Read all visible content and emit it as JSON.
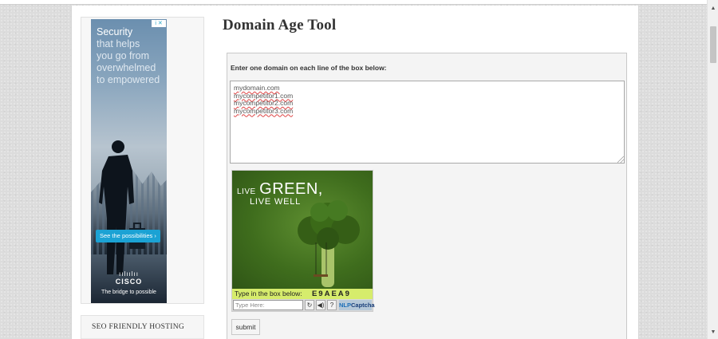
{
  "sidebar": {
    "ad": {
      "lines": [
        "Security",
        "that helps",
        "you go from",
        "overwhelmed",
        "to empowered"
      ],
      "badge": "i ✕",
      "cta": "See the possibilities ›",
      "logo_bars": "ıılıılıı",
      "brand": "CISCO",
      "tagline": "The bridge to possible"
    },
    "box_title": "SEO FRIENDLY HOSTING"
  },
  "main": {
    "title": "Domain Age Tool",
    "instruction": "Enter one domain on each line of the box below:",
    "domains": [
      "mydomain.com",
      "mycompetitor1.com",
      "mycompetitor2.com",
      "mycompetitor3.com"
    ],
    "captcha": {
      "live_small": "LIVE",
      "live_big": "GREEN,",
      "live_well": "LIVE WELL",
      "prompt": "Type in the box below:",
      "code": "E9AEA9",
      "input_placeholder": "Type Here:",
      "refresh": "↻",
      "audio": "◀)",
      "help": "?",
      "logo_nlp": "NLP",
      "logo_captcha": "Captcha"
    },
    "submit_label": "submit"
  },
  "scrollbar": {
    "up": "▲",
    "down": "▼"
  }
}
